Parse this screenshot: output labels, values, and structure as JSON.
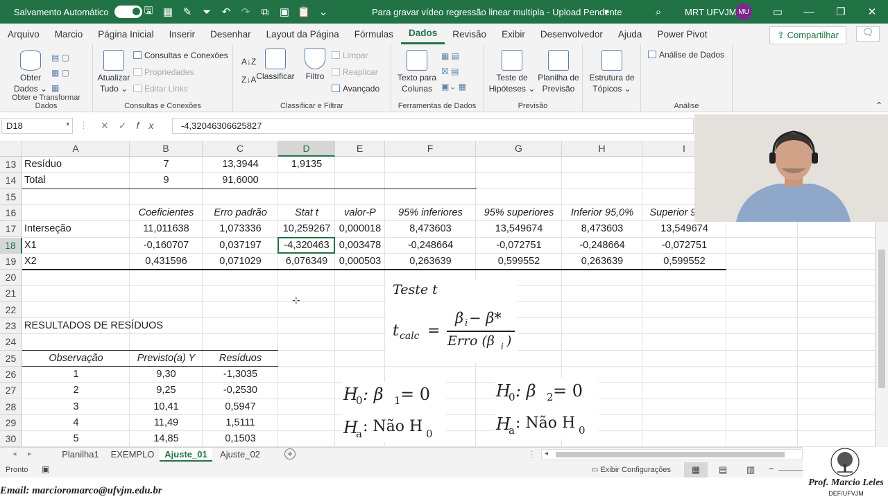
{
  "titlebar": {
    "autosave": "Salvamento Automático",
    "doc_title": "Para gravar vídeo regressão linear multipla  -  Upload Pendente",
    "user": "MRT UFVJM",
    "initials": "MU"
  },
  "tabs": [
    "Arquivo",
    "Marcio",
    "Página Inicial",
    "Inserir",
    "Desenhar",
    "Layout da Página",
    "Fórmulas",
    "Dados",
    "Revisão",
    "Exibir",
    "Desenvolvedor",
    "Ajuda",
    "Power Pivot"
  ],
  "share": "Compartilhar",
  "ribbon": {
    "g1": {
      "label": "Obter e Transformar Dados",
      "btn1": "Obter",
      "btn1b": "Dados ⌄"
    },
    "g2": {
      "label": "Consultas e Conexões",
      "btn1": "Atualizar",
      "btn1b": "Tudo ⌄",
      "s1": "Consultas e Conexões",
      "s2": "Propriedades",
      "s3": "Editar Links"
    },
    "g3": {
      "label": "Classificar e Filtrar",
      "sort": "Classificar",
      "filter": "Filtro",
      "s1": "Limpar",
      "s2": "Reaplicar",
      "s3": "Avançado"
    },
    "g4": {
      "label": "Ferramentas de Dados",
      "btn1": "Texto para",
      "btn1b": "Colunas"
    },
    "g5": {
      "label": "Previsão",
      "btn1": "Teste de",
      "btn1b": "Hipóteses ⌄",
      "btn2": "Planilha de",
      "btn2b": "Previsão"
    },
    "g6": {
      "label": "",
      "btn1": "Estrutura de",
      "btn1b": "Tópicos ⌄"
    },
    "g7": {
      "label": "Análise",
      "s1": "Análise de Dados"
    }
  },
  "formula_bar": {
    "namebox": "D18",
    "value": "-4,32046306625827"
  },
  "columns": [
    "A",
    "B",
    "C",
    "D",
    "E",
    "F",
    "G",
    "H",
    "I"
  ],
  "rows": [
    "13",
    "14",
    "15",
    "16",
    "17",
    "18",
    "19",
    "20",
    "21",
    "22",
    "23",
    "24",
    "25",
    "26",
    "27",
    "28",
    "29",
    "30"
  ],
  "cells": {
    "r13": [
      "Resíduo",
      "7",
      "13,3944",
      "1,9135"
    ],
    "r14": [
      "Total",
      "9",
      "91,6000"
    ],
    "r16": [
      "Coeficientes",
      "Erro padrão",
      "Stat t",
      "valor-P",
      "95% inferiores",
      "95% superiores",
      "Inferior 95,0%",
      "Superior 95,0%"
    ],
    "r17": [
      "Interseção",
      "11,011638",
      "1,073336",
      "10,259267",
      "0,000018",
      "8,473603",
      "13,549674",
      "8,473603",
      "13,549674"
    ],
    "r18": [
      "X1",
      "-0,160707",
      "0,037197",
      "-4,320463",
      "0,003478",
      "-0,248664",
      "-0,072751",
      "-0,248664",
      "-0,072751"
    ],
    "r19": [
      "X2",
      "0,431596",
      "0,071029",
      "6,076349",
      "0,000503",
      "0,263639",
      "0,599552",
      "0,263639",
      "0,599552"
    ],
    "r23": "RESULTADOS DE RESÍDUOS",
    "r25": [
      "Observação",
      "Previsto(a) Y",
      "Resíduos"
    ],
    "r26": [
      "1",
      "9,30",
      "-1,3035"
    ],
    "r27": [
      "2",
      "9,25",
      "-0,2530"
    ],
    "r28": [
      "3",
      "10,41",
      "0,5947"
    ],
    "r29": [
      "4",
      "11,49",
      "1,5111"
    ],
    "r30": [
      "5",
      "14,85",
      "0,1503"
    ]
  },
  "overlay": {
    "title": "Teste t",
    "t": "t",
    "calc": "calc",
    "eq": "=",
    "num": "β",
    "num_sub": "i",
    "num_rest": " − β*",
    "den": "Erro (β",
    "den_sub": "i",
    "den_end": ")",
    "h0a": "H",
    "h0a_sub": "0",
    "h0a_rest": ":  β",
    "h0a_b": "1",
    "h0a_end": " = 0",
    "haa": "H",
    "haa_sub": "a",
    "haa_rest": ": Não  H",
    "haa_end": "0",
    "h0b_b": "2"
  },
  "sheets": [
    "Planilha1",
    "EXEMPLO",
    "Ajuste_01",
    "Ajuste_02"
  ],
  "status": {
    "ready": "Pronto",
    "settings": "Exibir Configurações"
  },
  "email": "Email: marcioromarco@ufvjm.edu.br",
  "logo": {
    "name": "Prof. Marcio Leles",
    "dept": "DEF/UFVJM"
  },
  "colors": {
    "accent": "#217346"
  }
}
